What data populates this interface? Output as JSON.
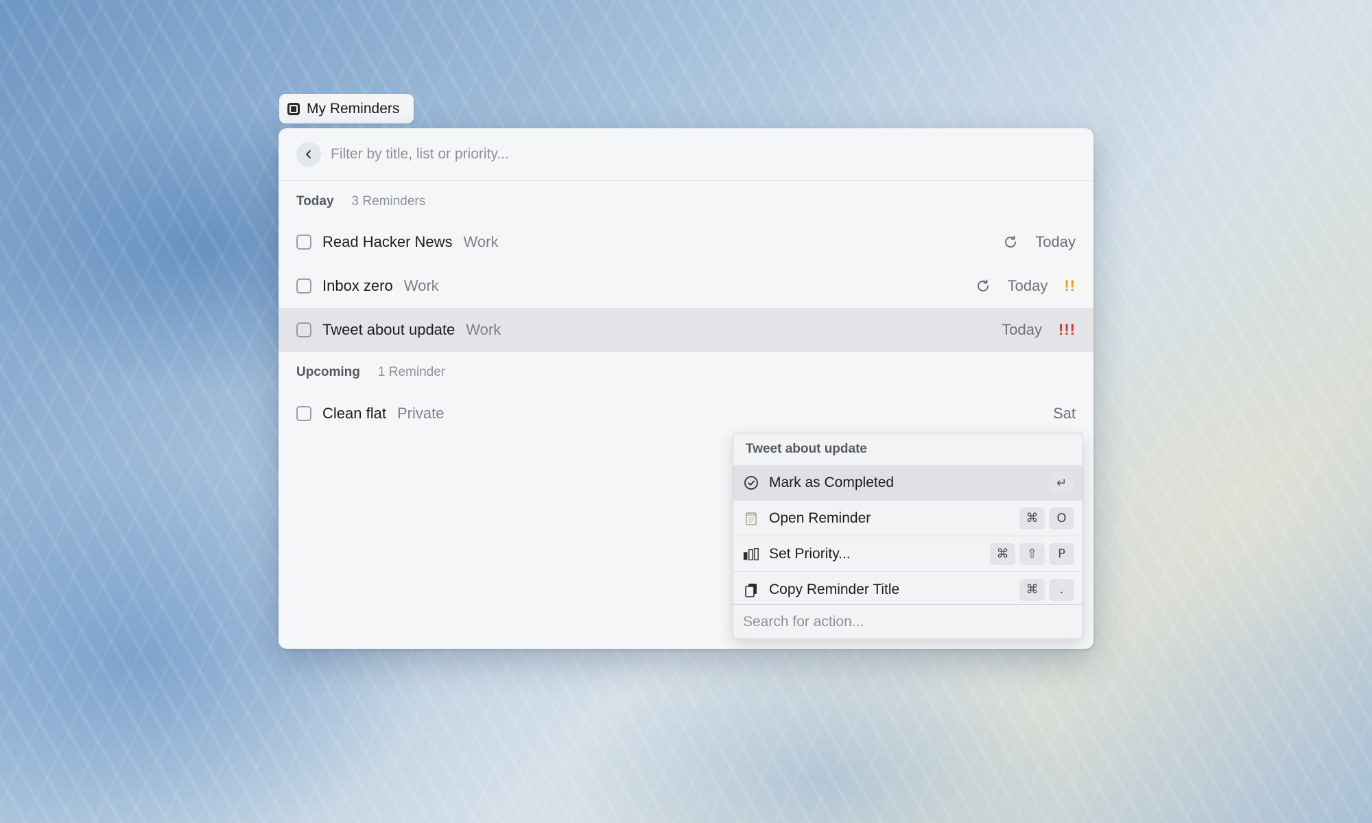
{
  "window": {
    "title": "My Reminders",
    "search_placeholder": "Filter by title, list or priority..."
  },
  "sections": {
    "today": {
      "title": "Today",
      "count": "3 Reminders"
    },
    "upcoming": {
      "title": "Upcoming",
      "count": "1 Reminder"
    }
  },
  "reminders": [
    {
      "title": "Read Hacker News",
      "list": "Work",
      "due": "Today",
      "repeat": true,
      "priority": ""
    },
    {
      "title": "Inbox zero",
      "list": "Work",
      "due": "Today",
      "repeat": true,
      "priority": "!!"
    },
    {
      "title": "Tweet about update",
      "list": "Work",
      "due": "Today",
      "repeat": false,
      "priority": "!!!"
    },
    {
      "title": "Clean flat",
      "list": "Private",
      "due": "Sat",
      "repeat": false,
      "priority": ""
    }
  ],
  "action_panel": {
    "header": "Tweet about update",
    "items": [
      {
        "label": "Mark as Completed",
        "icon": "checkmark-circle-icon",
        "keys": [
          "↵"
        ]
      },
      {
        "label": "Open Reminder",
        "icon": "notepad-icon",
        "keys": [
          "⌘",
          "O"
        ]
      },
      {
        "label": "Set Priority...",
        "icon": "priority-bars-icon",
        "keys": [
          "⌘",
          "⇧",
          "P"
        ]
      },
      {
        "label": "Copy Reminder Title",
        "icon": "copy-icon",
        "keys": [
          "⌘",
          "."
        ]
      }
    ],
    "search_placeholder": "Search for action..."
  },
  "colors": {
    "priority_medium": "#e6a400",
    "priority_high": "#d3332a",
    "selected_row": "#e2e4e7"
  }
}
